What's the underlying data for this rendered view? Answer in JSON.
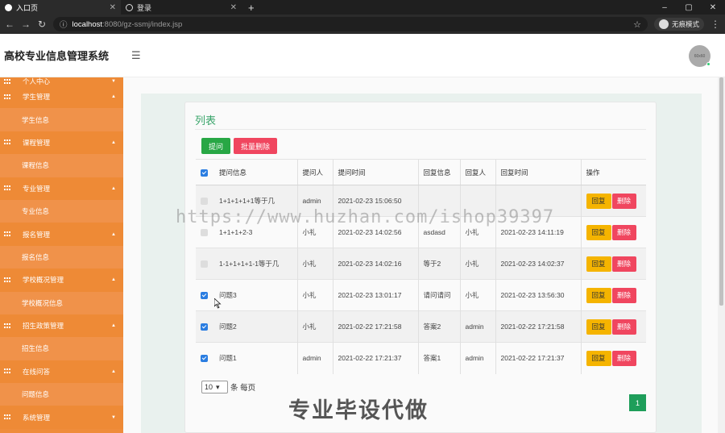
{
  "browser": {
    "tabs": [
      {
        "title": "入口页",
        "active": true
      },
      {
        "title": "登录",
        "active": false
      }
    ],
    "new_tab": "+",
    "window_controls": [
      "–",
      "▢",
      "✕"
    ],
    "url_host": "localhost",
    "url_rest": ":8080/gz-ssmj/index.jsp",
    "profile_label": "无痕模式"
  },
  "app": {
    "title": "高校专业信息管理系统",
    "avatar_text": "60x60"
  },
  "sidebar": {
    "items": [
      {
        "label": "个人中心",
        "type": "group",
        "expanded": false,
        "partial": true
      },
      {
        "label": "学生管理",
        "type": "group",
        "expanded": true
      },
      {
        "label": "学生信息",
        "type": "sub"
      },
      {
        "label": "课程管理",
        "type": "group",
        "expanded": true
      },
      {
        "label": "课程信息",
        "type": "sub"
      },
      {
        "label": "专业管理",
        "type": "group",
        "expanded": true
      },
      {
        "label": "专业信息",
        "type": "sub"
      },
      {
        "label": "报名管理",
        "type": "group",
        "expanded": true
      },
      {
        "label": "报名信息",
        "type": "sub"
      },
      {
        "label": "学校概况管理",
        "type": "group",
        "expanded": true
      },
      {
        "label": "学校概况信息",
        "type": "sub"
      },
      {
        "label": "招生政策管理",
        "type": "group",
        "expanded": true
      },
      {
        "label": "招生信息",
        "type": "sub"
      },
      {
        "label": "在线问答",
        "type": "group",
        "expanded": true
      },
      {
        "label": "问题信息",
        "type": "sub"
      },
      {
        "label": "系统管理",
        "type": "group",
        "expanded": false
      }
    ]
  },
  "main": {
    "card_title": "列表",
    "btn_ask": "提问",
    "btn_batch_delete": "批量删除",
    "columns": [
      "提问信息",
      "提问人",
      "提问时间",
      "回复信息",
      "回复人",
      "回复时间",
      "操作"
    ],
    "rows": [
      {
        "checked": false,
        "question": "1+1+1+1+1等于几",
        "asker": "admin",
        "ask_time": "2021-02-23 15:06:50",
        "reply": "",
        "replier": "",
        "reply_time": ""
      },
      {
        "checked": false,
        "question": "1+1+1+2-3",
        "asker": "小礼",
        "ask_time": "2021-02-23 14:02:56",
        "reply": "asdasd",
        "replier": "小礼",
        "reply_time": "2021-02-23 14:11:19"
      },
      {
        "checked": false,
        "question": "1-1+1+1+1-1等于几",
        "asker": "小礼",
        "ask_time": "2021-02-23 14:02:16",
        "reply": "等于2",
        "replier": "小礼",
        "reply_time": "2021-02-23 14:02:37"
      },
      {
        "checked": true,
        "question": "问题3",
        "asker": "小礼",
        "ask_time": "2021-02-23 13:01:17",
        "reply": "请问请问",
        "replier": "小礼",
        "reply_time": "2021-02-23 13:56:30"
      },
      {
        "checked": true,
        "question": "问题2",
        "asker": "小礼",
        "ask_time": "2021-02-22 17:21:58",
        "reply": "答案2",
        "replier": "admin",
        "reply_time": "2021-02-22 17:21:58"
      },
      {
        "checked": true,
        "question": "问题1",
        "asker": "admin",
        "ask_time": "2021-02-22 17:21:37",
        "reply": "答案1",
        "replier": "admin",
        "reply_time": "2021-02-22 17:21:37"
      }
    ],
    "action_reply": "回复",
    "action_delete": "删除",
    "page_size": "10",
    "page_size_suffix": "条 每页",
    "current_page": "1"
  },
  "overlays": {
    "watermark": "https://www.huzhan.com/ishop39397",
    "promo": "专业毕设代做"
  },
  "colors": {
    "sidebar": "#ef8c3b",
    "accent_green": "#28a745",
    "danger": "#f0465f",
    "warning": "#f5b400",
    "checkbox": "#2a7de1"
  }
}
